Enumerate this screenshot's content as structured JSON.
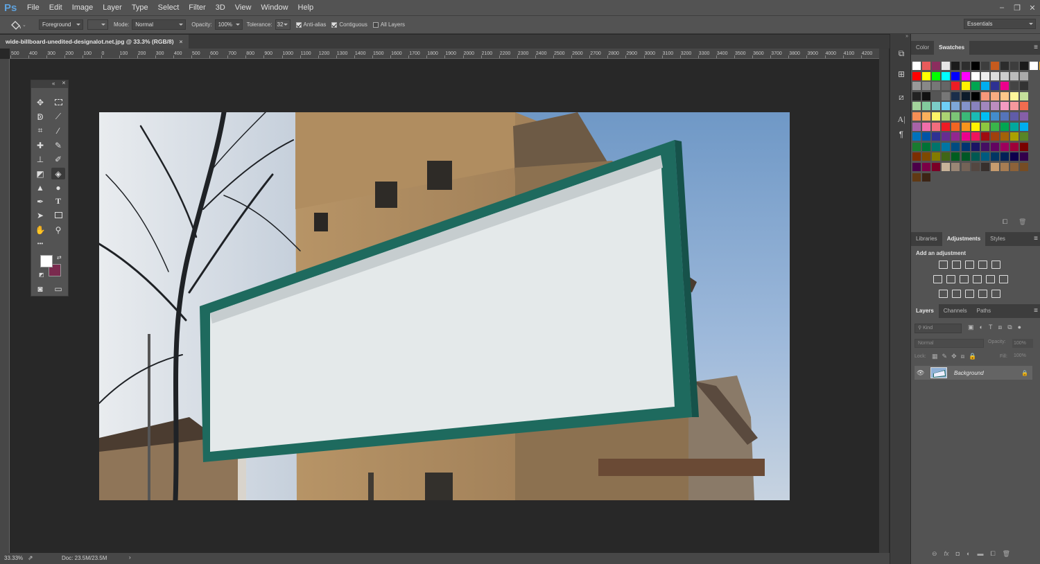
{
  "app": {
    "logo": "Ps"
  },
  "menu": [
    "File",
    "Edit",
    "Image",
    "Layer",
    "Type",
    "Select",
    "Filter",
    "3D",
    "View",
    "Window",
    "Help"
  ],
  "window_controls": [
    "–",
    "❐",
    "✕"
  ],
  "options": {
    "tool_icon": "paint-bucket-icon",
    "fill_source": "Foreground",
    "mode_label": "Mode:",
    "mode_value": "Normal",
    "opacity_label": "Opacity:",
    "opacity_value": "100%",
    "tolerance_label": "Tolerance:",
    "tolerance_value": "32",
    "anti_alias": "Anti-alias",
    "contiguous": "Contiguous",
    "all_layers": "All Layers",
    "workspace": "Essentials"
  },
  "document": {
    "tab_title": "wide-billboard-unedited-designalot.net.jpg @ 33.3% (RGB/8)",
    "close": "×",
    "ruler_labels": [
      "500",
      "400",
      "300",
      "200",
      "100",
      "0",
      "100",
      "200",
      "300",
      "400",
      "500",
      "600",
      "700",
      "800",
      "900",
      "1000",
      "1100",
      "1200",
      "1300",
      "1400",
      "1500",
      "1600",
      "1700",
      "1800",
      "1900",
      "2000",
      "2100",
      "2200",
      "2300",
      "2400",
      "2500",
      "2600",
      "2700",
      "2800",
      "2900",
      "3000",
      "3100",
      "3200",
      "3300",
      "3400",
      "3500",
      "3600",
      "3700",
      "3800",
      "3900",
      "4000",
      "4100",
      "4200"
    ]
  },
  "status": {
    "zoom": "33.33%",
    "doc": "Doc: 23.5M/23.5M",
    "arrow": "›"
  },
  "toolbox": {
    "collapse": "«",
    "close": "✕",
    "more": "•••"
  },
  "colors": {
    "foreground": "#ffffff",
    "background": "#7a2a4e",
    "accent": "#5fa2dd",
    "billboard_frame": "#1e6a5e"
  },
  "panels": {
    "color_tabs": [
      "Color",
      "Swatches"
    ],
    "adjust_tabs": [
      "Libraries",
      "Adjustments",
      "Styles"
    ],
    "add_adjustment": "Add an adjustment",
    "layers_tabs": [
      "Layers",
      "Channels",
      "Paths"
    ],
    "kind_label": "Kind",
    "blend_mode": "Normal",
    "opacity_label": "Opacity:",
    "opacity_value": "100%",
    "lock_label": "Lock:",
    "fill_label": "Fill:",
    "fill_value": "100%",
    "layer_name": "Background",
    "bottom_icons": [
      "link-icon",
      "fx-icon",
      "mask-icon",
      "adjustment-layer-icon",
      "group-icon",
      "new-layer-icon",
      "trash-icon"
    ]
  }
}
